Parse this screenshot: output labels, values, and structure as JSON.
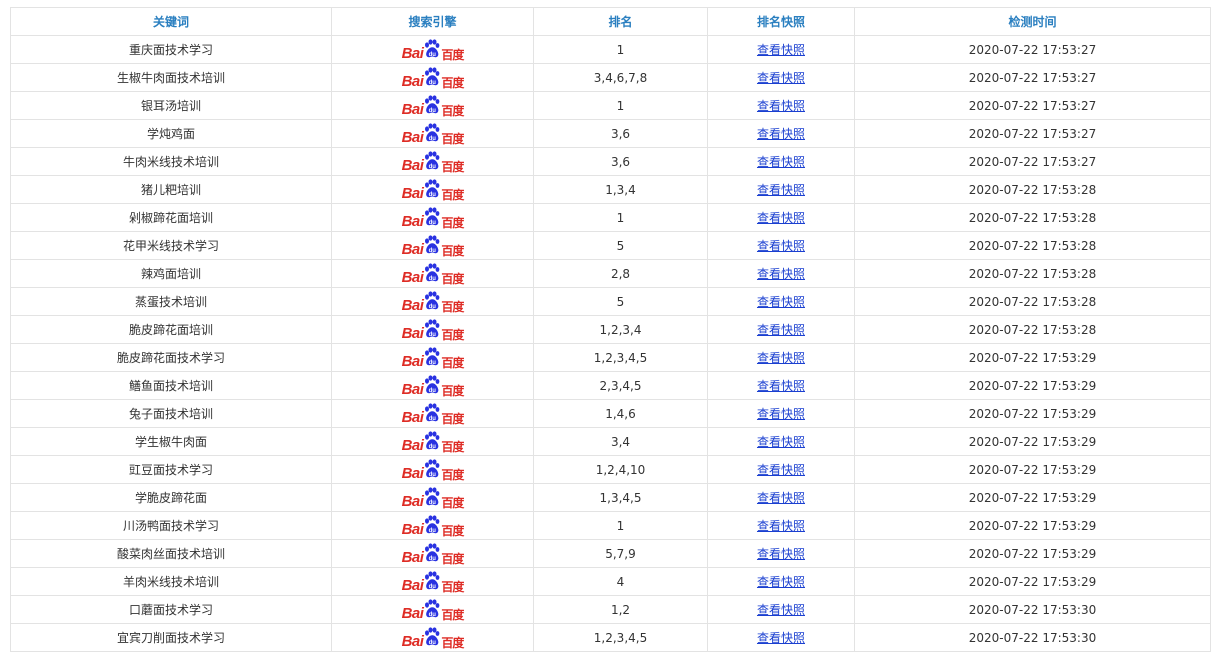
{
  "headers": {
    "keyword": "关键词",
    "engine": "搜索引擎",
    "rank": "排名",
    "snapshot": "排名快照",
    "time": "检测时间"
  },
  "logo_text": {
    "bai": "Bai",
    "cn": "百度"
  },
  "colors": {
    "header_text": "#2a7fc0",
    "logo_red": "#de2c25",
    "logo_blue": "#2932e1",
    "link": "#1a3fd0"
  },
  "rows": [
    {
      "keyword": "重庆面技术学习",
      "rank": "1",
      "snapshot": "查看快照",
      "time": "2020-07-22 17:53:27"
    },
    {
      "keyword": "生椒牛肉面技术培训",
      "rank": "3,4,6,7,8",
      "snapshot": "查看快照",
      "time": "2020-07-22 17:53:27"
    },
    {
      "keyword": "银耳汤培训",
      "rank": "1",
      "snapshot": "查看快照",
      "time": "2020-07-22 17:53:27"
    },
    {
      "keyword": "学炖鸡面",
      "rank": "3,6",
      "snapshot": "查看快照",
      "time": "2020-07-22 17:53:27"
    },
    {
      "keyword": "牛肉米线技术培训",
      "rank": "3,6",
      "snapshot": "查看快照",
      "time": "2020-07-22 17:53:27"
    },
    {
      "keyword": "猪儿粑培训",
      "rank": "1,3,4",
      "snapshot": "查看快照",
      "time": "2020-07-22 17:53:28"
    },
    {
      "keyword": "剁椒蹄花面培训",
      "rank": "1",
      "snapshot": "查看快照",
      "time": "2020-07-22 17:53:28"
    },
    {
      "keyword": "花甲米线技术学习",
      "rank": "5",
      "snapshot": "查看快照",
      "time": "2020-07-22 17:53:28"
    },
    {
      "keyword": "辣鸡面培训",
      "rank": "2,8",
      "snapshot": "查看快照",
      "time": "2020-07-22 17:53:28"
    },
    {
      "keyword": "蒸蛋技术培训",
      "rank": "5",
      "snapshot": "查看快照",
      "time": "2020-07-22 17:53:28"
    },
    {
      "keyword": "脆皮蹄花面培训",
      "rank": "1,2,3,4",
      "snapshot": "查看快照",
      "time": "2020-07-22 17:53:28"
    },
    {
      "keyword": "脆皮蹄花面技术学习",
      "rank": "1,2,3,4,5",
      "snapshot": "查看快照",
      "time": "2020-07-22 17:53:29"
    },
    {
      "keyword": "鳝鱼面技术培训",
      "rank": "2,3,4,5",
      "snapshot": "查看快照",
      "time": "2020-07-22 17:53:29"
    },
    {
      "keyword": "兔子面技术培训",
      "rank": "1,4,6",
      "snapshot": "查看快照",
      "time": "2020-07-22 17:53:29"
    },
    {
      "keyword": "学生椒牛肉面",
      "rank": "3,4",
      "snapshot": "查看快照",
      "time": "2020-07-22 17:53:29"
    },
    {
      "keyword": "豇豆面技术学习",
      "rank": "1,2,4,10",
      "snapshot": "查看快照",
      "time": "2020-07-22 17:53:29"
    },
    {
      "keyword": "学脆皮蹄花面",
      "rank": "1,3,4,5",
      "snapshot": "查看快照",
      "time": "2020-07-22 17:53:29"
    },
    {
      "keyword": "川汤鸭面技术学习",
      "rank": "1",
      "snapshot": "查看快照",
      "time": "2020-07-22 17:53:29"
    },
    {
      "keyword": "酸菜肉丝面技术培训",
      "rank": "5,7,9",
      "snapshot": "查看快照",
      "time": "2020-07-22 17:53:29"
    },
    {
      "keyword": "羊肉米线技术培训",
      "rank": "4",
      "snapshot": "查看快照",
      "time": "2020-07-22 17:53:29"
    },
    {
      "keyword": "口蘑面技术学习",
      "rank": "1,2",
      "snapshot": "查看快照",
      "time": "2020-07-22 17:53:30"
    },
    {
      "keyword": "宜宾刀削面技术学习",
      "rank": "1,2,3,4,5",
      "snapshot": "查看快照",
      "time": "2020-07-22 17:53:30"
    }
  ]
}
